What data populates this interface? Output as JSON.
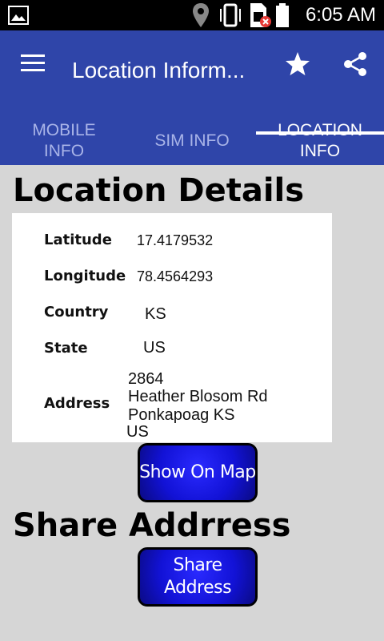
{
  "status_bar": {
    "time": "6:05 AM"
  },
  "app_bar": {
    "title": "Location Inform...",
    "colors": {
      "primary": "#2f45a9"
    }
  },
  "tabs": [
    {
      "line1": "MOBILE",
      "line2": "INFO"
    },
    {
      "line1": "SIM INFO",
      "line2": ""
    },
    {
      "line1": "LOCATION",
      "line2": "INFO"
    }
  ],
  "location_details": {
    "heading": "Location Details",
    "rows": [
      {
        "label": "Latitude",
        "value": "17.4179532"
      },
      {
        "label": "Longitude",
        "value": "78.4564293"
      },
      {
        "label": "Country",
        "value": "KS"
      },
      {
        "label": "State",
        "value": "US"
      }
    ],
    "address": {
      "label": "Address",
      "lines": [
        "2864",
        "Heather Blosom Rd",
        "Ponkapoag KS",
        "US"
      ]
    }
  },
  "buttons": {
    "show_on_map": "Show On Map",
    "share_address": "Share Address"
  },
  "share": {
    "heading": "Share Addrress"
  },
  "icons": [
    "gallery-icon",
    "location-icon",
    "vibrate-icon",
    "sim-icon",
    "battery-icon",
    "menu-icon",
    "star-icon",
    "share-icon"
  ]
}
